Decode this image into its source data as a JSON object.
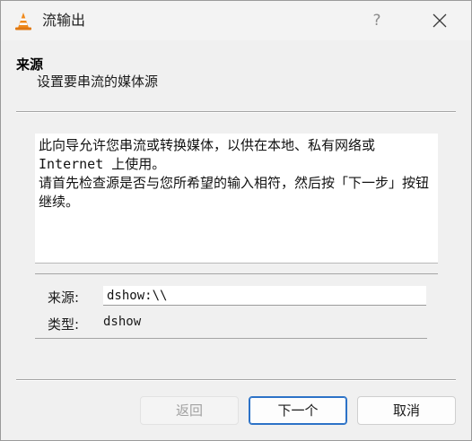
{
  "window": {
    "title": "流输出",
    "help_label": "?"
  },
  "header": {
    "title": "来源",
    "subtitle": "设置要串流的媒体源"
  },
  "description": "此向导允许您串流或转换媒体，以供在本地、私有网络或 Internet 上使用。\n请首先检查源是否与您所希望的输入相符，然后按「下一步」按钮继续。",
  "source": {
    "label": "来源:",
    "value": "dshow:\\\\"
  },
  "type": {
    "label": "类型:",
    "value": "dshow"
  },
  "buttons": {
    "back": "返回",
    "next": "下一个",
    "cancel": "取消"
  },
  "colors": {
    "accent": "#2c72c7",
    "vlc_orange": "#f08a1c"
  }
}
